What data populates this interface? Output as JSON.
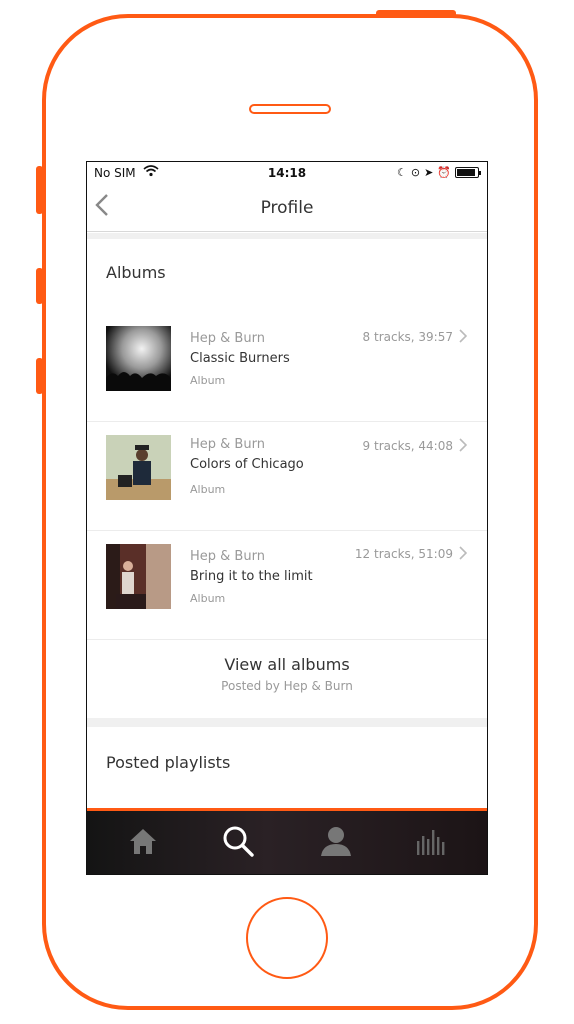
{
  "status_bar": {
    "carrier": "No SIM",
    "time": "14:18"
  },
  "nav": {
    "title": "Profile",
    "back_icon": "chevron-left-icon"
  },
  "sections": {
    "albums_title": "Albums",
    "playlists_title": "Posted playlists"
  },
  "albums": [
    {
      "artist": "Hep & Burn",
      "title": "Classic Burners",
      "kind": "Album",
      "meta": "8 tracks, 39:57"
    },
    {
      "artist": "Hep & Burn",
      "title": "Colors of Chicago",
      "kind": "Album",
      "meta": "9 tracks, 44:08"
    },
    {
      "artist": "Hep & Burn",
      "title": "Bring it to the limit",
      "kind": "Album",
      "meta": "12 tracks, 51:09"
    }
  ],
  "view_all": {
    "label": "View all albums",
    "posted_by": "Posted by Hep & Burn"
  },
  "tabs": [
    {
      "icon": "home-icon"
    },
    {
      "icon": "search-icon"
    },
    {
      "icon": "profile-icon"
    },
    {
      "icon": "stream-icon"
    }
  ],
  "colors": {
    "accent": "#ff5a14",
    "tabbar_bg": "#1c1416"
  }
}
